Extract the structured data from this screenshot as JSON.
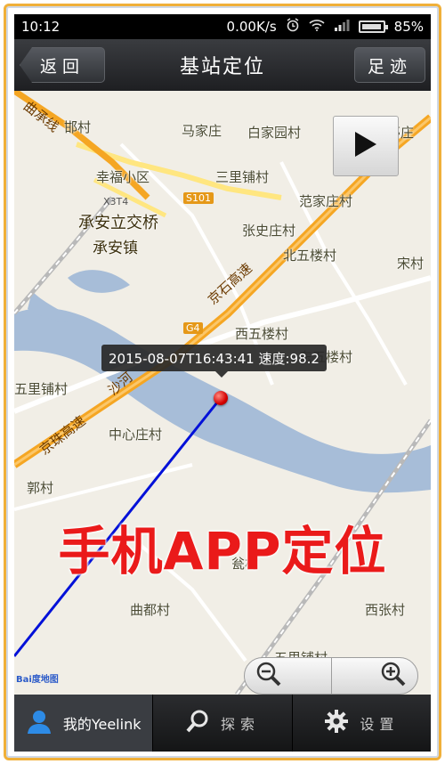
{
  "status_bar": {
    "time": "10:12",
    "network_speed": "0.00K/s",
    "battery": "85%",
    "icons": [
      "alarm-icon",
      "wifi-icon",
      "signal-icon",
      "battery-icon"
    ]
  },
  "title_bar": {
    "title": "基站定位",
    "back_label": "返回",
    "track_label": "足迹"
  },
  "map": {
    "places": [
      "邯村",
      "马家庄",
      "白家园村",
      "里亭庄",
      "幸福小区",
      "三里铺村",
      "承安立交桥",
      "承安镇",
      "范家庄村",
      "张史庄村",
      "北五楼村",
      "宋村",
      "西五楼村",
      "东五楼村",
      "五里铺村",
      "中心庄村",
      "郭村",
      "曲都村",
      "西张村",
      "五里铺村",
      "瓮村"
    ],
    "road_labels": [
      "曲承线",
      "X3T4",
      "S101",
      "京石高速",
      "G4",
      "京珠高速",
      "沙河"
    ],
    "tooltip": "2015-08-07T16:43:41 速度:98.2",
    "overlay_text": "手机APP定位",
    "baidu_logo": "Bai度地图"
  },
  "tab_bar": {
    "tabs": [
      {
        "label": "我的Yeelink",
        "icon": "user-icon",
        "active": true
      },
      {
        "label": "探索",
        "icon": "search-icon",
        "active": false
      },
      {
        "label": "设置",
        "icon": "gear-icon",
        "active": false
      }
    ]
  },
  "colors": {
    "road_major": "#f5a623",
    "river": "#a7bdd8",
    "track_line": "#0010d8",
    "overlay_text": "#ea1a1a"
  }
}
